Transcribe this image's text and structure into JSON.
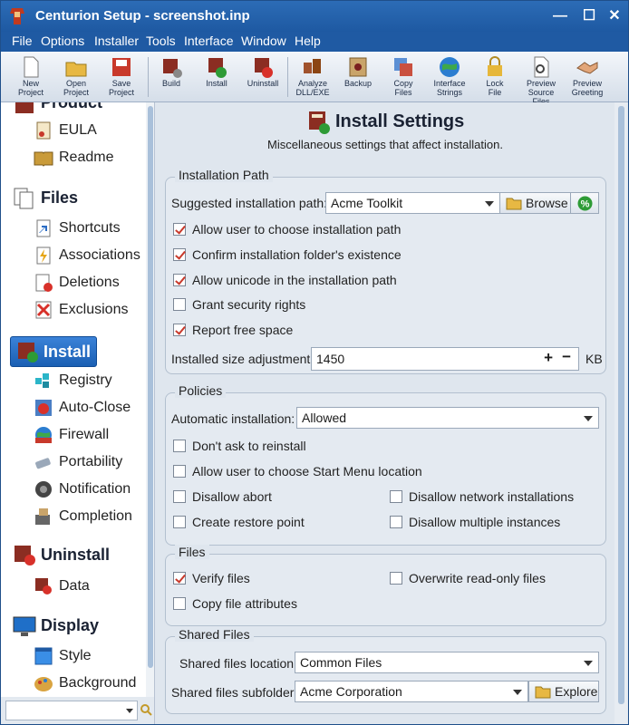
{
  "window": {
    "title": "Centurion Setup - screenshot.inp"
  },
  "menu": [
    "File",
    "Options",
    "Installer",
    "Tools",
    "Interface",
    "Window",
    "Help"
  ],
  "toolbar": [
    {
      "line1": "New",
      "line2": "Project",
      "icon": "new-project-icon"
    },
    {
      "line1": "Open",
      "line2": "Project",
      "icon": "open-project-icon"
    },
    {
      "line1": "Save",
      "line2": "Project",
      "icon": "save-project-icon"
    },
    {
      "line1": "Build",
      "line2": "",
      "icon": "build-icon"
    },
    {
      "line1": "Install",
      "line2": "",
      "icon": "install-icon"
    },
    {
      "line1": "Uninstall",
      "line2": "",
      "icon": "uninstall-icon"
    },
    {
      "line1": "Analyze",
      "line2": "DLL/EXE",
      "icon": "analyze-icon"
    },
    {
      "line1": "Backup",
      "line2": "",
      "icon": "backup-icon"
    },
    {
      "line1": "Copy",
      "line2": "Files",
      "icon": "copy-files-icon"
    },
    {
      "line1": "Interface",
      "line2": "Strings",
      "icon": "interface-strings-icon"
    },
    {
      "line1": "Lock",
      "line2": "File",
      "icon": "lock-file-icon"
    },
    {
      "line1": "Preview",
      "line2": "Source Files",
      "icon": "preview-source-icon"
    },
    {
      "line1": "Preview",
      "line2": "Greeting",
      "icon": "preview-greeting-icon"
    }
  ],
  "sidebar": {
    "product": "Product",
    "eula": "EULA",
    "readme": "Readme",
    "files": "Files",
    "shortcuts": "Shortcuts",
    "associations": "Associations",
    "deletions": "Deletions",
    "exclusions": "Exclusions",
    "install": "Install",
    "registry": "Registry",
    "autoclose": "Auto-Close",
    "firewall": "Firewall",
    "portability": "Portability",
    "notification": "Notification",
    "completion": "Completion",
    "uninstall": "Uninstall",
    "data": "Data",
    "display": "Display",
    "style": "Style",
    "background": "Background"
  },
  "header": {
    "title": "Install Settings",
    "subtitle": "Miscellaneous settings that affect installation."
  },
  "installation_path": {
    "legend": "Installation Path",
    "suggested_label": "Suggested installation path:",
    "suggested_value": "Acme Toolkit",
    "browse": "Browse",
    "checks": [
      {
        "label": "Allow user to choose installation path",
        "checked": true
      },
      {
        "label": "Confirm installation folder's existence",
        "checked": true
      },
      {
        "label": "Allow unicode in the installation path",
        "checked": true
      },
      {
        "label": "Grant security rights",
        "checked": false
      },
      {
        "label": "Report free space",
        "checked": true
      }
    ],
    "size_label": "Installed size adjustment:",
    "size_value": "1450",
    "size_unit": "KB"
  },
  "policies": {
    "legend": "Policies",
    "auto_label": "Automatic installation:",
    "auto_value": "Allowed",
    "checks": [
      {
        "label": "Don't ask to reinstall",
        "checked": false
      },
      {
        "label": "Allow user to choose Start Menu location",
        "checked": false
      },
      {
        "label": "Disallow abort",
        "checked": false
      },
      {
        "label": "Disallow network installations",
        "checked": false
      },
      {
        "label": "Create restore point",
        "checked": false
      },
      {
        "label": "Disallow multiple instances",
        "checked": false
      }
    ]
  },
  "files": {
    "legend": "Files",
    "checks": [
      {
        "label": "Verify files",
        "checked": true
      },
      {
        "label": "Overwrite read-only files",
        "checked": false
      },
      {
        "label": "Copy file attributes",
        "checked": false
      }
    ]
  },
  "shared": {
    "legend": "Shared Files",
    "location_label": "Shared files location:",
    "location_value": "Common Files",
    "subfolder_label": "Shared files subfolder:",
    "subfolder_value": "Acme Corporation",
    "explore": "Explore"
  }
}
